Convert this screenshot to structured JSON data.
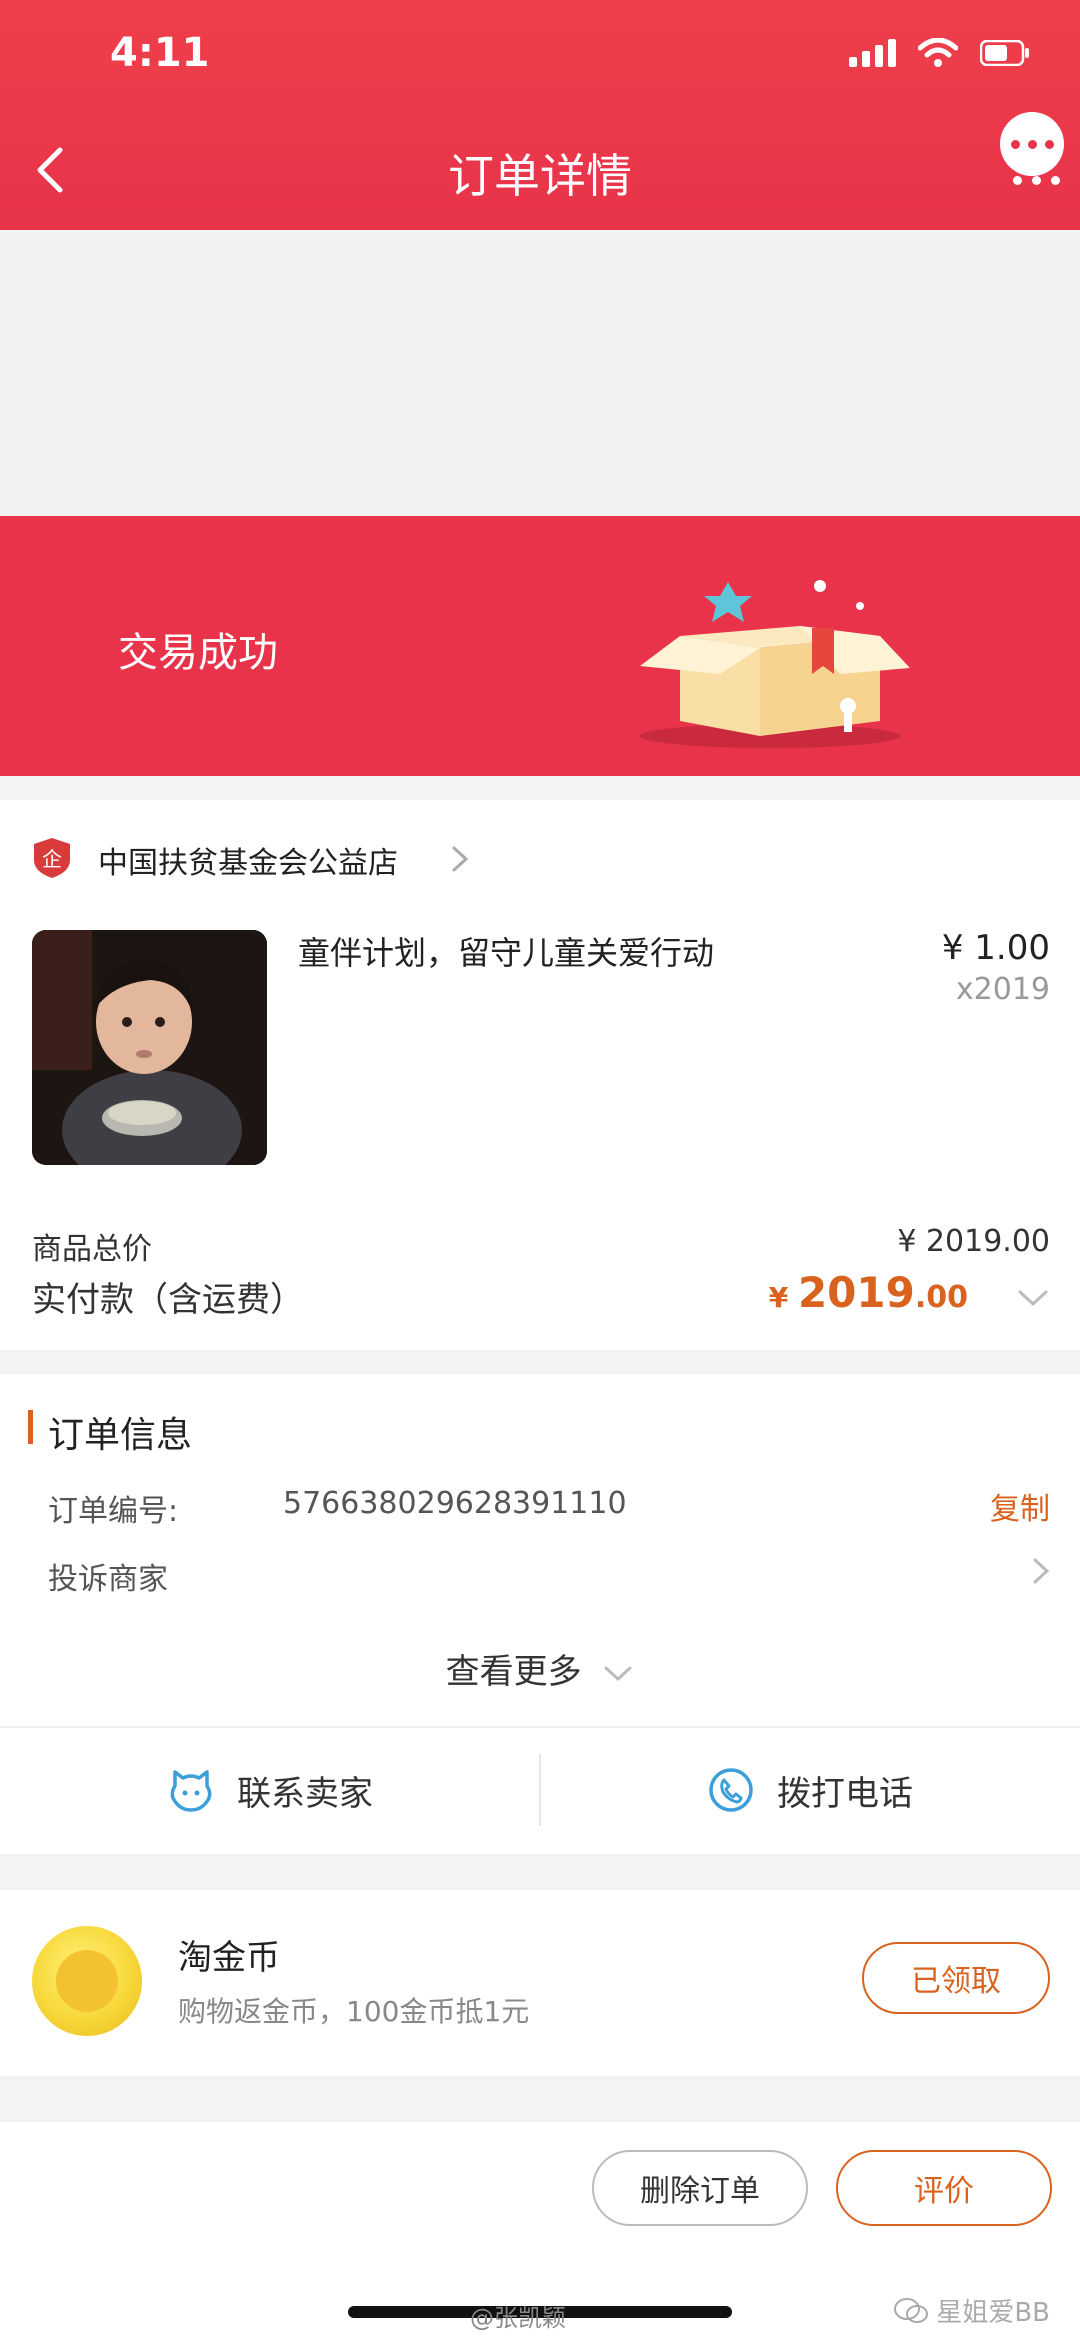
{
  "status_bar": {
    "time": "4:11"
  },
  "nav": {
    "title": "订单详情"
  },
  "order_status": {
    "text": "交易成功"
  },
  "shop": {
    "name": "中国扶贫基金会公益店",
    "badge": "企"
  },
  "product": {
    "title": "童伴计划，留守儿童关爱行动",
    "price": "¥ 1.00",
    "quantity": "x2019"
  },
  "totals": {
    "subtotal_label": "商品总价",
    "subtotal_value": "¥ 2019.00",
    "paid_label": "实付款（含运费）",
    "paid_currency": "¥ ",
    "paid_integer": "2019",
    "paid_decimal": ".00"
  },
  "order_info": {
    "title": "订单信息",
    "number_label": "订单编号:",
    "number_value": "576638029628391110",
    "copy_label": "复制",
    "complaint_label": "投诉商家",
    "see_more_label": "查看更多"
  },
  "actions": {
    "contact_seller": "联系卖家",
    "call_phone": "拨打电话"
  },
  "coins": {
    "title": "淘金币",
    "subtitle": "购物返金币，100金币抵1元",
    "button": "已领取"
  },
  "bottom": {
    "delete_label": "删除订单",
    "review_label": "评价"
  },
  "watermarks": {
    "weibo": "@张凯颖",
    "wechat": "星姐爱BB"
  },
  "colors": {
    "brand_red": "#e8334a",
    "accent_orange": "#d9621f"
  }
}
